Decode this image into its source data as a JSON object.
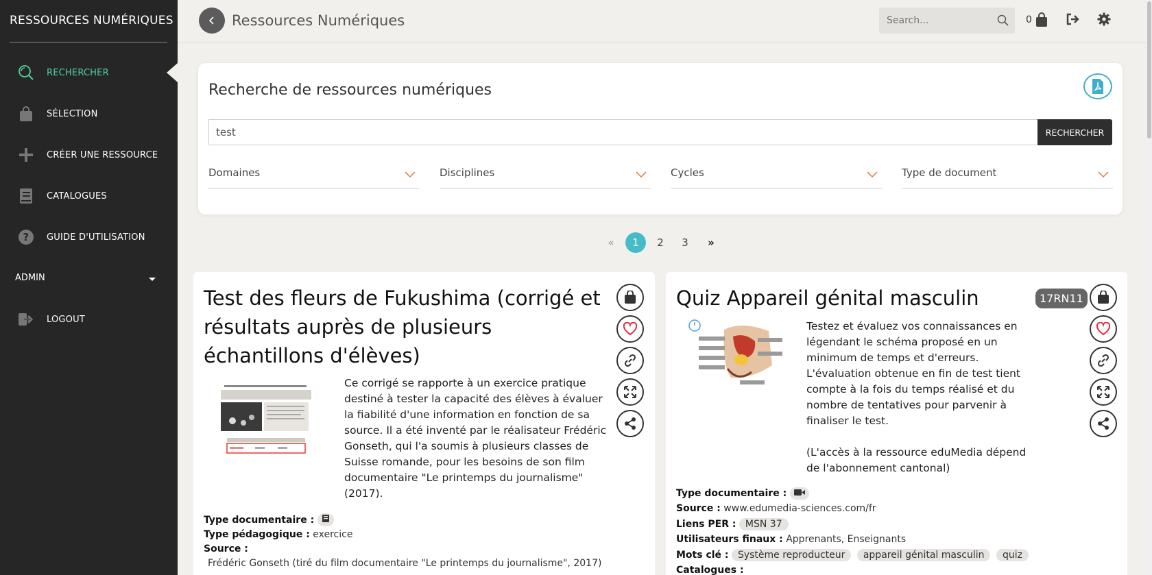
{
  "sidebar": {
    "title": "RESSOURCES NUMÉRIQUES",
    "items": [
      {
        "label": "RECHERCHER",
        "icon": "search-icon"
      },
      {
        "label": "SÉLECTION",
        "icon": "bag-icon"
      },
      {
        "label": "CRÉER UNE RESSOURCE",
        "icon": "plus-icon"
      },
      {
        "label": "CATALOGUES",
        "icon": "book-icon"
      },
      {
        "label": "GUIDE D'UTILISATION",
        "icon": "question-icon"
      }
    ],
    "admin_label": "ADMIN",
    "logout_label": "LOGOUT"
  },
  "topbar": {
    "title": "Ressources Numériques",
    "search_placeholder": "Search...",
    "cart_count": "0"
  },
  "search_panel": {
    "title": "Recherche de ressources numériques",
    "query": "test",
    "button_label": "RECHERCHER",
    "filters": [
      "Domaines",
      "Disciplines",
      "Cycles",
      "Type de document"
    ]
  },
  "pagination": {
    "first": "«",
    "pages": [
      "1",
      "2",
      "3"
    ],
    "current": "1",
    "last": "»"
  },
  "results": [
    {
      "title": "Test des fleurs de Fukushima (corrigé et résultats auprès de plusieurs échantillons d'élèves)",
      "description": "Ce corrigé se rapporte à un exercice pratique destiné à tester la capacité des élèves à évaluer la fiabilité d'une information en fonction de sa source. Il a été inventé par le réalisateur Frédéric Gonseth, qui l'a soumis à plusieurs classes de Suisse romande, pour les besoins de son film documentaire \"Le printemps du journalisme\" (2017).",
      "type_doc_label": "Type documentaire :",
      "type_doc_icon": "book-icon",
      "type_peda_label": "Type pédagogique :",
      "type_peda_value": "exercice",
      "source_label": "Source :",
      "source_value": "Frédéric Gonseth (tiré du film documentaire \"Le printemps du journalisme\", 2017)"
    },
    {
      "title": "Quiz Appareil génital masculin",
      "badge": "17RN11",
      "description_1": "Testez et évaluez vos connaissances en légendant le schéma proposé en un minimum de temps et d'erreurs. L'évaluation obtenue en fin de test tient compte à la fois du temps réalisé et du nombre de tentatives pour parvenir à finaliser le test.",
      "description_2": "(L'accès à la ressource eduMedia dépend de l'abonnement cantonal)",
      "type_doc_label": "Type documentaire :",
      "type_doc_icon": "video-icon",
      "source_label": "Source :",
      "source_value": "www.edumedia-sciences.com/fr",
      "per_label": "Liens PER :",
      "per_value": "MSN 37",
      "users_label": "Utilisateurs finaux :",
      "users_value": "Apprenants, Enseignants",
      "keywords_label": "Mots clé :",
      "keywords": [
        "Système reproducteur",
        "appareil génital masculin",
        "quiz"
      ],
      "catalogues_label": "Catalogues :"
    }
  ],
  "colors": {
    "sidebar_bg": "#262626",
    "active": "#4fd1a0",
    "accent": "#45bcc7",
    "chevron": "#e07b39"
  }
}
